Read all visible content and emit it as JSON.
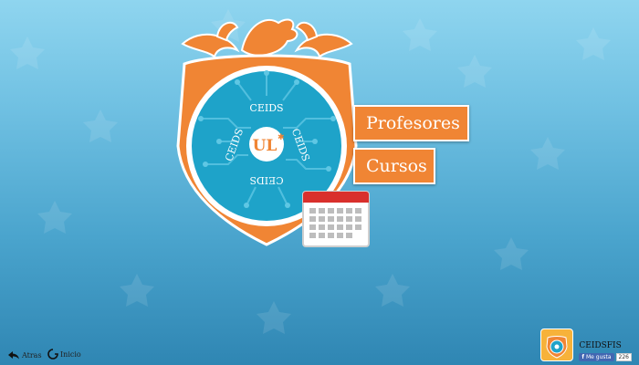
{
  "crest": {
    "logo_text": "UL",
    "ring_text_top": "CEIDS",
    "ring_text_left": "CEIDS",
    "ring_text_right": "CEIDS",
    "ring_text_bottom": "CEIDS"
  },
  "menu": {
    "profesores_label": "Profesores",
    "cursos_label": "Cursos"
  },
  "footer": {
    "back_label": "Atras",
    "home_label": "Inicio"
  },
  "brand": {
    "name": "CEIDSFIS",
    "like_label": "Me gusta",
    "like_count": "226"
  },
  "colors": {
    "accent_orange": "#f08534",
    "badge_blue": "#1ea3c9",
    "calendar_red": "#d9302c",
    "facebook_blue": "#4267b2"
  },
  "icons": [
    "dragon-crest-icon",
    "calendar-icon",
    "back-arrow-icon",
    "home-swirl-icon",
    "facebook-icon"
  ]
}
